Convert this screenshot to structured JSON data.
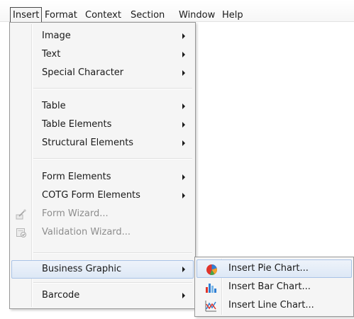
{
  "menubar": {
    "insert": "Insert",
    "format": "Format",
    "context": "Context",
    "section": "Section",
    "window": "Window",
    "help": "Help"
  },
  "insert_menu": {
    "image": "Image",
    "text": "Text",
    "special_character": "Special Character",
    "table": "Table",
    "table_elements": "Table Elements",
    "structural_elements": "Structural Elements",
    "form_elements": "Form Elements",
    "cotg_form_elements": "COTG Form Elements",
    "form_wizard": "Form Wizard...",
    "validation_wizard": "Validation Wizard...",
    "business_graphic": "Business Graphic",
    "barcode": "Barcode"
  },
  "business_graphic_submenu": {
    "pie_chart": "Insert Pie Chart...",
    "bar_chart": "Insert Bar Chart...",
    "line_chart": "Insert Line Chart..."
  },
  "colors": {
    "highlight_border": "#a9c3e6",
    "highlight_fill": "#dde8f6",
    "disabled_text": "#8d8d8d",
    "menu_background": "#f5f5f5"
  },
  "icons": {
    "form_wizard": "wand-icon",
    "validation_wizard": "validation-check-icon",
    "pie_chart": "pie-chart-icon",
    "bar_chart": "bar-chart-icon",
    "line_chart": "line-chart-icon",
    "submenu": "chevron-right-icon"
  }
}
